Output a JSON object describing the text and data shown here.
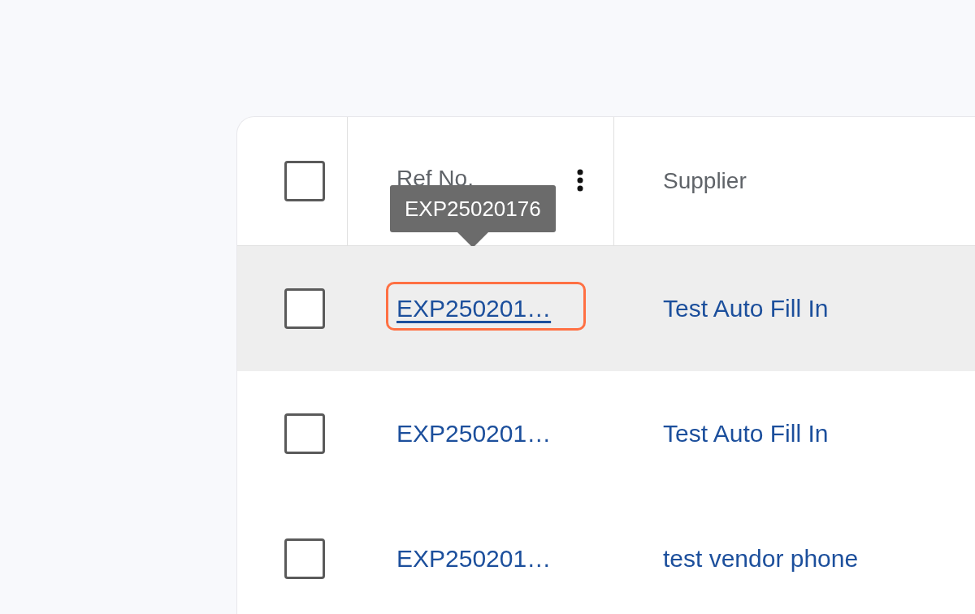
{
  "table": {
    "columns": [
      {
        "label": "Ref No.",
        "tooltip": "EXP25020176"
      },
      {
        "label": "Supplier"
      }
    ],
    "select_all": {
      "checked": false
    },
    "rows": [
      {
        "ref": "EXP250201…",
        "supplier": "Test Auto Fill In",
        "checked": false,
        "hovered": true,
        "highlighted": true
      },
      {
        "ref": "EXP250201…",
        "supplier": "Test Auto Fill In",
        "checked": false,
        "hovered": false,
        "highlighted": false
      },
      {
        "ref": "EXP250201…",
        "supplier": "test vendor phone",
        "checked": false,
        "hovered": false,
        "highlighted": false
      }
    ]
  }
}
